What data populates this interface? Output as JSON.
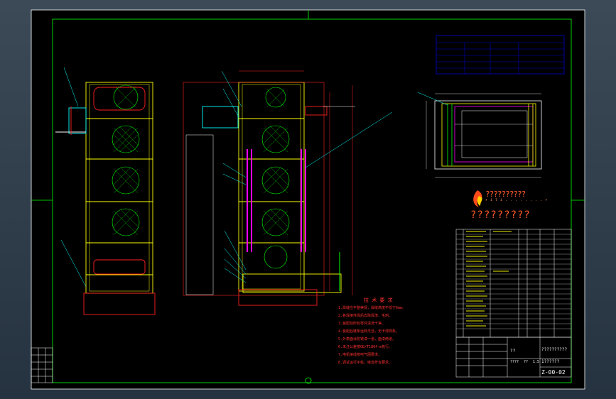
{
  "logo": {
    "main_text": "??????????",
    "sub_text": "r i l i . . . . . . . . r",
    "tagline": "?????????"
  },
  "title_block": {
    "title": "??????????",
    "qq": "??",
    "drawing_no": "1??????",
    "code": "Z-00-02",
    "meta1": "????",
    "meta2": "??",
    "meta3": "1:5"
  },
  "notes": {
    "title": "技 术 要 求",
    "items": [
      "1.焊缝应平整美观，焊缝高度不低于6mm。",
      "2.各焊接件焊后去除焊渣、毛刺。",
      "3.装配前所有零件清洗干净。",
      "4.装配后链条运转灵活，无卡滞现象。",
      "5.外表面涂防锈漆一道，面漆两道。",
      "6.未注公差按GB/T1804-m执行。",
      "7.电机接线按电气图要求。",
      "8.调试运行平稳，噪音符合要求。"
    ]
  },
  "colors": {
    "frame": "#ffff00",
    "cyan": "#00ffff",
    "red": "#ff2020",
    "white": "#ffffff",
    "green": "#00ff00",
    "magenta": "#ff00ff",
    "blue_table": "#0000cc"
  }
}
